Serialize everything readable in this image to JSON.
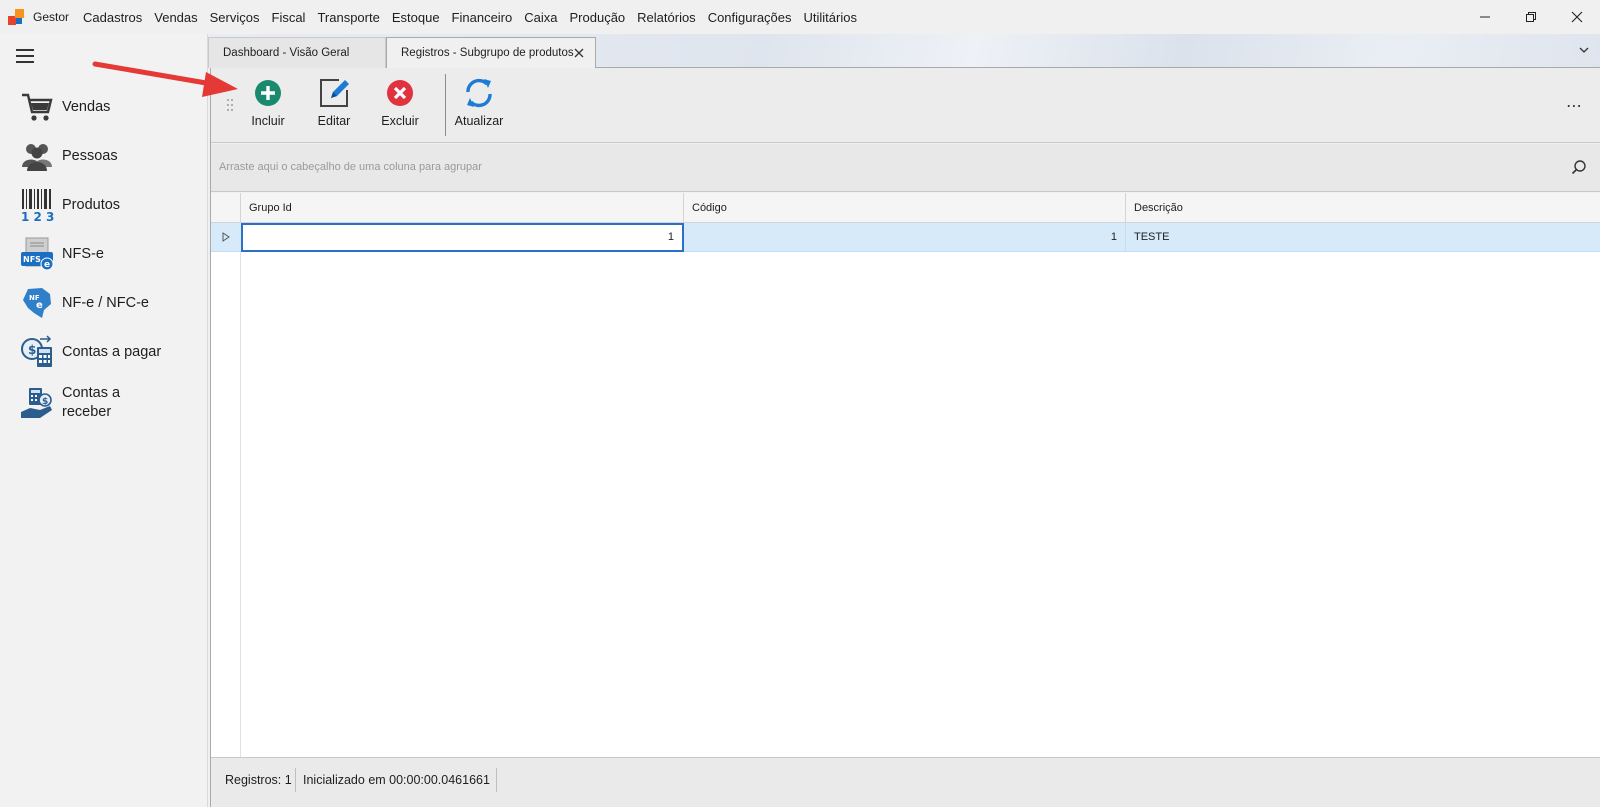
{
  "menubar": {
    "items": [
      "Gestor",
      "Cadastros",
      "Vendas",
      "Serviços",
      "Fiscal",
      "Transporte",
      "Estoque",
      "Financeiro",
      "Caixa",
      "Produção",
      "Relatórios",
      "Configurações",
      "Utilitários"
    ]
  },
  "window_controls": {
    "minimize": "minimize-icon",
    "restore": "restore-icon",
    "close": "close-icon"
  },
  "sidebar": {
    "items": [
      {
        "label": "Vendas",
        "icon": "cart-icon"
      },
      {
        "label": "Pessoas",
        "icon": "people-icon"
      },
      {
        "label": "Produtos",
        "icon": "barcode-icon"
      },
      {
        "label": "NFS-e",
        "icon": "nfse-icon"
      },
      {
        "label": "NF-e / NFC-e",
        "icon": "nfe-icon"
      },
      {
        "label": "Contas a pagar",
        "icon": "calculator-icon"
      },
      {
        "label": "Contas a receber",
        "icon": "hand-money-icon"
      }
    ]
  },
  "tabs": [
    {
      "label": "Dashboard - Visão Geral",
      "active": false
    },
    {
      "label": "Registros - Subgrupo de produtos",
      "active": true
    }
  ],
  "toolbar": {
    "buttons": [
      {
        "label": "Incluir",
        "icon": "add-icon"
      },
      {
        "label": "Editar",
        "icon": "edit-icon"
      },
      {
        "label": "Excluir",
        "icon": "delete-icon"
      },
      {
        "label": "Atualizar",
        "icon": "refresh-icon"
      }
    ],
    "more": "⋯"
  },
  "group_panel": {
    "hint": "Arraste aqui o cabeçalho de uma coluna para agrupar"
  },
  "grid": {
    "columns": [
      "Grupo Id",
      "Código",
      "Descrição"
    ],
    "rows": [
      {
        "grupo_id": "1",
        "codigo": "1",
        "descricao": "TESTE"
      }
    ]
  },
  "status": {
    "records": "Registros: 1",
    "initialized": "Inicializado em 00:00:00.0461661"
  },
  "colors": {
    "accent": "#2b6fc7",
    "selected_row": "#d6eaf9",
    "add_green": "#1a8a6e",
    "delete_red": "#e0323f",
    "refresh_blue": "#1b7bd6",
    "annotation_red": "#e53935"
  }
}
